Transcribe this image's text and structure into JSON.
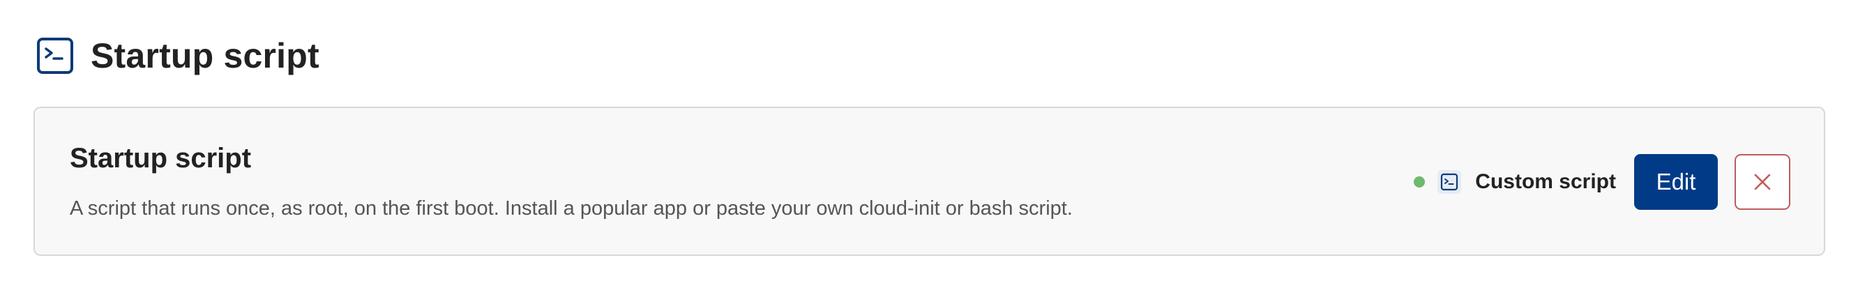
{
  "header": {
    "title": "Startup script",
    "icon": "terminal-icon"
  },
  "card": {
    "title": "Startup script",
    "description": "A script that runs once, as root, on the first boot. Install a popular app or paste your own cloud-init or bash script.",
    "status": {
      "color": "#6db96f"
    },
    "script": {
      "icon": "terminal-icon",
      "label": "Custom script"
    },
    "edit_label": "Edit",
    "remove_icon": "close-icon"
  },
  "colors": {
    "accent": "#013b87",
    "danger": "#c25a5a",
    "status_ok": "#6db96f"
  }
}
